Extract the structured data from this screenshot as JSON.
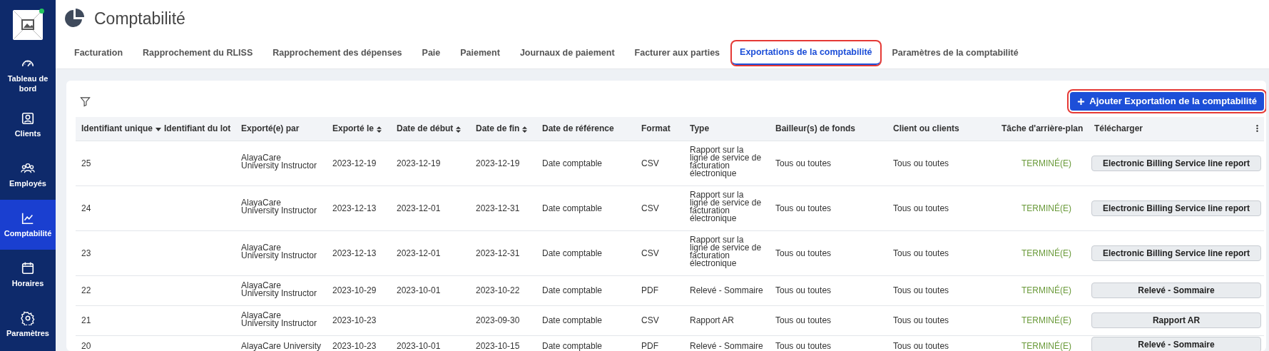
{
  "sidebar": {
    "items": [
      {
        "label": "Tableau de bord",
        "selected": false
      },
      {
        "label": "Clients",
        "selected": false
      },
      {
        "label": "Employés",
        "selected": false
      },
      {
        "label": "Comptabilité",
        "selected": true
      },
      {
        "label": "Horaires",
        "selected": false
      },
      {
        "label": "Paramètres",
        "selected": false
      }
    ]
  },
  "header": {
    "title": "Comptabilité"
  },
  "tabs": [
    {
      "label": "Facturation",
      "selected": false,
      "highlighted": false
    },
    {
      "label": "Rapprochement du RLISS",
      "selected": false,
      "highlighted": false
    },
    {
      "label": "Rapprochement des dépenses",
      "selected": false,
      "highlighted": false
    },
    {
      "label": "Paie",
      "selected": false,
      "highlighted": false
    },
    {
      "label": "Paiement",
      "selected": false,
      "highlighted": false
    },
    {
      "label": "Journaux de paiement",
      "selected": false,
      "highlighted": false
    },
    {
      "label": "Facturer aux parties",
      "selected": false,
      "highlighted": false
    },
    {
      "label": "Exportations de la comptabilité",
      "selected": true,
      "highlighted": true
    },
    {
      "label": "Paramètres de la comptabilité",
      "selected": false,
      "highlighted": false
    }
  ],
  "add_button": {
    "label": "Ajouter Exportation de la comptabilité",
    "highlighted": true
  },
  "table": {
    "columns": [
      {
        "label": "Identifiant unique",
        "sortable": true,
        "sorted_descending": true
      },
      {
        "label": "Identifiant du lot",
        "sortable": false,
        "sorted_descending": false
      },
      {
        "label": "Exporté(e) par",
        "sortable": false,
        "sorted_descending": false
      },
      {
        "label": "Exporté le",
        "sortable": true,
        "sorted_descending": false
      },
      {
        "label": "Date de début",
        "sortable": true,
        "sorted_descending": false
      },
      {
        "label": "Date de fin",
        "sortable": true,
        "sorted_descending": false
      },
      {
        "label": "Date de référence",
        "sortable": false,
        "sorted_descending": false
      },
      {
        "label": "Format",
        "sortable": false,
        "sorted_descending": false
      },
      {
        "label": "Type",
        "sortable": false,
        "sorted_descending": false
      },
      {
        "label": "Bailleur(s) de fonds",
        "sortable": false,
        "sorted_descending": false
      },
      {
        "label": "Client ou clients",
        "sortable": false,
        "sorted_descending": false
      },
      {
        "label": "Tâche d'arrière-plan",
        "sortable": false,
        "sorted_descending": false
      },
      {
        "label": "Télécharger",
        "sortable": false,
        "sorted_descending": false
      }
    ],
    "rows": [
      {
        "id": "25",
        "batch": "",
        "by": "AlayaCare University Instructor",
        "exported": "2023-12-19",
        "start": "2023-12-19",
        "end": "2023-12-19",
        "ref": "Date comptable",
        "format": "CSV",
        "type": "Rapport sur la ligne de service de facturation électronique",
        "funders": "Tous ou toutes",
        "clients": "Tous ou toutes",
        "status": "TERMINÉ(E)",
        "download": "Electronic Billing Service line report"
      },
      {
        "id": "24",
        "batch": "",
        "by": "AlayaCare University Instructor",
        "exported": "2023-12-13",
        "start": "2023-12-01",
        "end": "2023-12-31",
        "ref": "Date comptable",
        "format": "CSV",
        "type": "Rapport sur la ligne de service de facturation électronique",
        "funders": "Tous ou toutes",
        "clients": "Tous ou toutes",
        "status": "TERMINÉ(E)",
        "download": "Electronic Billing Service line report"
      },
      {
        "id": "23",
        "batch": "",
        "by": "AlayaCare University Instructor",
        "exported": "2023-12-13",
        "start": "2023-12-01",
        "end": "2023-12-31",
        "ref": "Date comptable",
        "format": "CSV",
        "type": "Rapport sur la ligne de service de facturation électronique",
        "funders": "Tous ou toutes",
        "clients": "Tous ou toutes",
        "status": "TERMINÉ(E)",
        "download": "Electronic Billing Service line report"
      },
      {
        "id": "22",
        "batch": "",
        "by": "AlayaCare University Instructor",
        "exported": "2023-10-29",
        "start": "2023-10-01",
        "end": "2023-10-22",
        "ref": "Date comptable",
        "format": "PDF",
        "type": "Relevé - Sommaire",
        "funders": "Tous ou toutes",
        "clients": "Tous ou toutes",
        "status": "TERMINÉ(E)",
        "download": "Relevé - Sommaire"
      },
      {
        "id": "21",
        "batch": "",
        "by": "AlayaCare University Instructor",
        "exported": "2023-10-23",
        "start": "",
        "end": "2023-09-30",
        "ref": "Date comptable",
        "format": "CSV",
        "type": "Rapport AR",
        "funders": "Tous ou toutes",
        "clients": "Tous ou toutes",
        "status": "TERMINÉ(E)",
        "download": "Rapport AR"
      },
      {
        "id": "20",
        "batch": "",
        "by": "AlayaCare University",
        "exported": "2023-10-23",
        "start": "2023-10-01",
        "end": "2023-10-15",
        "ref": "Date comptable",
        "format": "PDF",
        "type": "Relevé - Sommaire",
        "funders": "Tous ou toutes",
        "clients": "Tous ou toutes",
        "status": "TERMINÉ(E)",
        "download": "Relevé - Sommaire"
      }
    ]
  }
}
